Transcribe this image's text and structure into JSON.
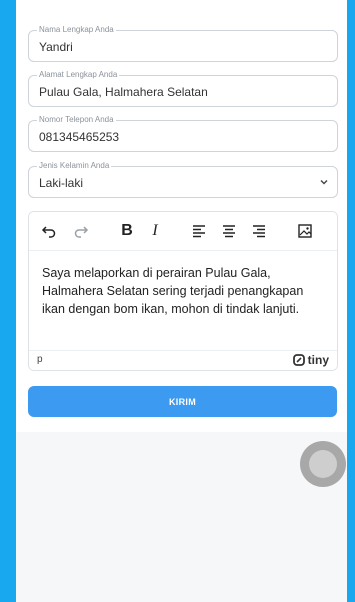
{
  "form": {
    "name": {
      "legend": "Nama Lengkap Anda",
      "value": "Yandri"
    },
    "address": {
      "legend": "Alamat Lengkap Anda",
      "value": "Pulau Gala, Halmahera Selatan"
    },
    "phone": {
      "legend": "Nomor Telepon Anda",
      "value": "081345465253"
    },
    "gender": {
      "legend": "Jenis Kelamin Anda",
      "value": "Laki-laki"
    }
  },
  "editor": {
    "toolbar_icons": [
      "undo-icon",
      "redo-icon",
      "bold-icon",
      "italic-icon",
      "align-left-icon",
      "align-center-icon",
      "align-right-icon",
      "image-icon"
    ],
    "bold_glyph": "B",
    "italic_glyph": "I",
    "content": "Saya melaporkan di perairan Pulau Gala, Halmahera Selatan sering terjadi penangkapan ikan dengan bom ikan, mohon di tindak lanjuti.",
    "status_path": "p",
    "brand": "tiny"
  },
  "submit_label": "KIRIM",
  "colors": {
    "background": "#18a8f0",
    "button": "#3c9af0"
  }
}
